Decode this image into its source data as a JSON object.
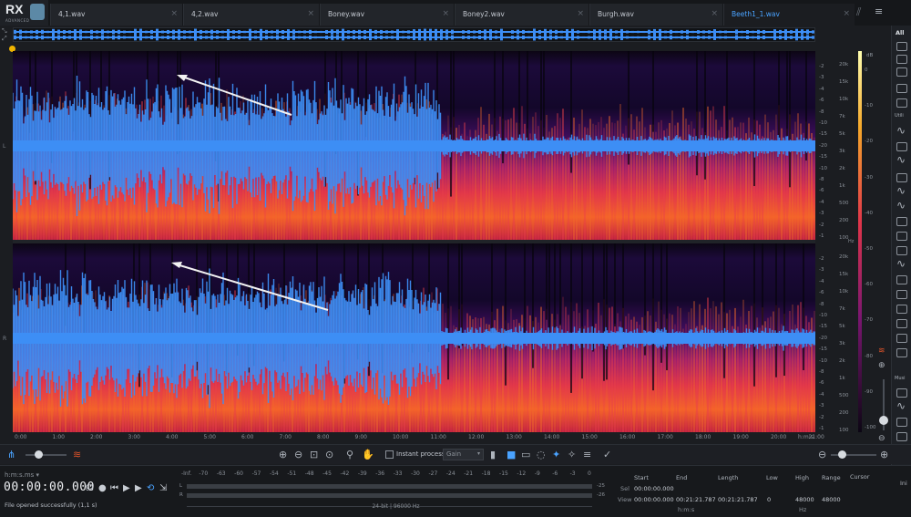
{
  "app": {
    "logo_text": "RX",
    "logo_sub": "ADVANCED"
  },
  "tabs": [
    {
      "label": "4,1.wav",
      "active": false
    },
    {
      "label": "4,2.wav",
      "active": false
    },
    {
      "label": "Boney.wav",
      "active": false
    },
    {
      "label": "Boney2.wav",
      "active": false
    },
    {
      "label": "Burgh.wav",
      "active": false
    },
    {
      "label": "Beeth1_1.wav",
      "active": true
    }
  ],
  "channels": [
    {
      "label": "L"
    },
    {
      "label": "R"
    }
  ],
  "freq_scale": [
    "20k",
    "15k",
    "10k",
    "7k",
    "5k",
    "3k",
    "2k",
    "1k",
    "500",
    "200",
    "100"
  ],
  "freq_unit": "Hz",
  "wave_db_scale": [
    "-2",
    "-3",
    "-4",
    "-6",
    "-8",
    "-10",
    "-15",
    "-20",
    "-15",
    "-10",
    "-8",
    "-6",
    "-4",
    "-3",
    "-2",
    "-1"
  ],
  "db_scale": {
    "unit": "dB",
    "values": [
      "0",
      "-10",
      "-20",
      "-30",
      "-40",
      "-50",
      "-60",
      "-70",
      "-80",
      "-90",
      "-100"
    ]
  },
  "time_ruler": {
    "ticks": [
      "0:00",
      "1:00",
      "2:00",
      "3:00",
      "4:00",
      "5:00",
      "6:00",
      "7:00",
      "8:00",
      "9:00",
      "10:00",
      "11:00",
      "12:00",
      "13:00",
      "14:00",
      "15:00",
      "16:00",
      "17:00",
      "18:00",
      "19:00",
      "20:00",
      "21:00"
    ],
    "unit": "h:m:s"
  },
  "rail": {
    "top_label": "All",
    "labels": [
      "Utili",
      "Musi",
      "Ini"
    ]
  },
  "toolbar": {
    "instant_process_label": "Instant process",
    "gain_value": "Gain"
  },
  "transport": {
    "time_format": "h:m:s.ms",
    "time_format_arrow": "▾",
    "current_time": "00:00:00.000",
    "status_message": "File opened successfully (1,1 s)"
  },
  "meter": {
    "scale": [
      "-Inf.",
      "-70",
      "-63",
      "-60",
      "-57",
      "-54",
      "-51",
      "-48",
      "-45",
      "-42",
      "-39",
      "-36",
      "-33",
      "-30",
      "-27",
      "-24",
      "-21",
      "-18",
      "-15",
      "-12",
      "-9",
      "-6",
      "-3",
      "0"
    ],
    "channels": [
      {
        "label": "L",
        "value": "-25"
      },
      {
        "label": "R",
        "value": "-26"
      }
    ],
    "format_info": "24-bit | 96000 Hz"
  },
  "selection_panel": {
    "headers": {
      "start": "Start",
      "end": "End",
      "length": "Length",
      "low": "Low",
      "high": "High",
      "range": "Range",
      "cursor": "Cursor"
    },
    "sel_label": "Sel",
    "view_label": "View",
    "sel_start": "00:00:00.000",
    "view_start": "00:00:00.000",
    "view_end": "00:21:21.787",
    "view_length": "00:21:21.787",
    "view_low": "0",
    "view_high": "48000",
    "view_range": "48000",
    "time_unit": "h:m:s",
    "freq_unit": "Hz"
  },
  "colors": {
    "accent": "#4aa3ff",
    "waveform": "#3d8ef5",
    "marker": "#f0b400"
  }
}
